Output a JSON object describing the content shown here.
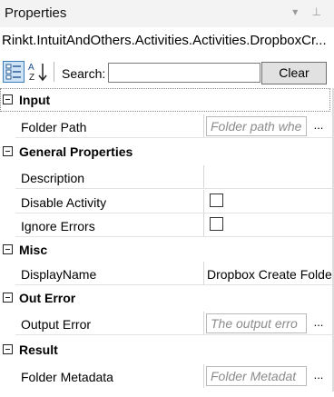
{
  "panel": {
    "title": "Properties",
    "controls_icon": "dropdown-and-pin-icon"
  },
  "type_name": "Rinkt.IntuitAndOthers.Activities.Activities.DropboxCr...",
  "toolbar": {
    "categorized_icon": "categorized-view-icon",
    "alphabetical_icon": "sort-alphabetical-icon",
    "search_label": "Search:",
    "search_value": "",
    "clear_label": "Clear"
  },
  "categories": {
    "input": {
      "label": "Input",
      "folder_path": {
        "name": "Folder Path",
        "placeholder": "Folder path whe",
        "button": "..."
      }
    },
    "general": {
      "label": "General Properties",
      "description": {
        "name": "Description"
      },
      "disable_activity": {
        "name": "Disable Activity",
        "checked": false
      },
      "ignore_errors": {
        "name": "Ignore Errors",
        "checked": false
      }
    },
    "misc": {
      "label": "Misc",
      "display_name": {
        "name": "DisplayName",
        "value": "Dropbox Create Folde"
      }
    },
    "out_error": {
      "label": "Out Error",
      "output_error": {
        "name": "Output Error",
        "placeholder": "The output erro",
        "button": "..."
      }
    },
    "result": {
      "label": "Result",
      "folder_metadata": {
        "name": "Folder Metadata",
        "placeholder": "Folder Metadat",
        "button": "..."
      }
    }
  }
}
